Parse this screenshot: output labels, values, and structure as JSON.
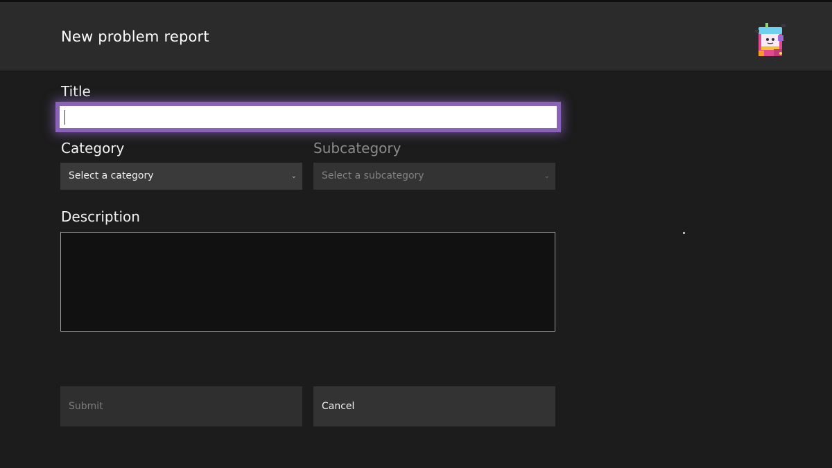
{
  "header": {
    "title": "New problem report",
    "avatar_icon": "arcade-cabinet-avatar-icon"
  },
  "form": {
    "title_label": "Title",
    "title_value": "",
    "category_label": "Category",
    "category_selected": "Select a category",
    "subcategory_label": "Subcategory",
    "subcategory_selected": "Select a subcategory",
    "description_label": "Description",
    "description_value": ""
  },
  "actions": {
    "submit_label": "Submit",
    "cancel_label": "Cancel"
  },
  "colors": {
    "focus_border": "#8a63b8",
    "background": "#1c1c1c",
    "header": "#2b2b2b"
  }
}
